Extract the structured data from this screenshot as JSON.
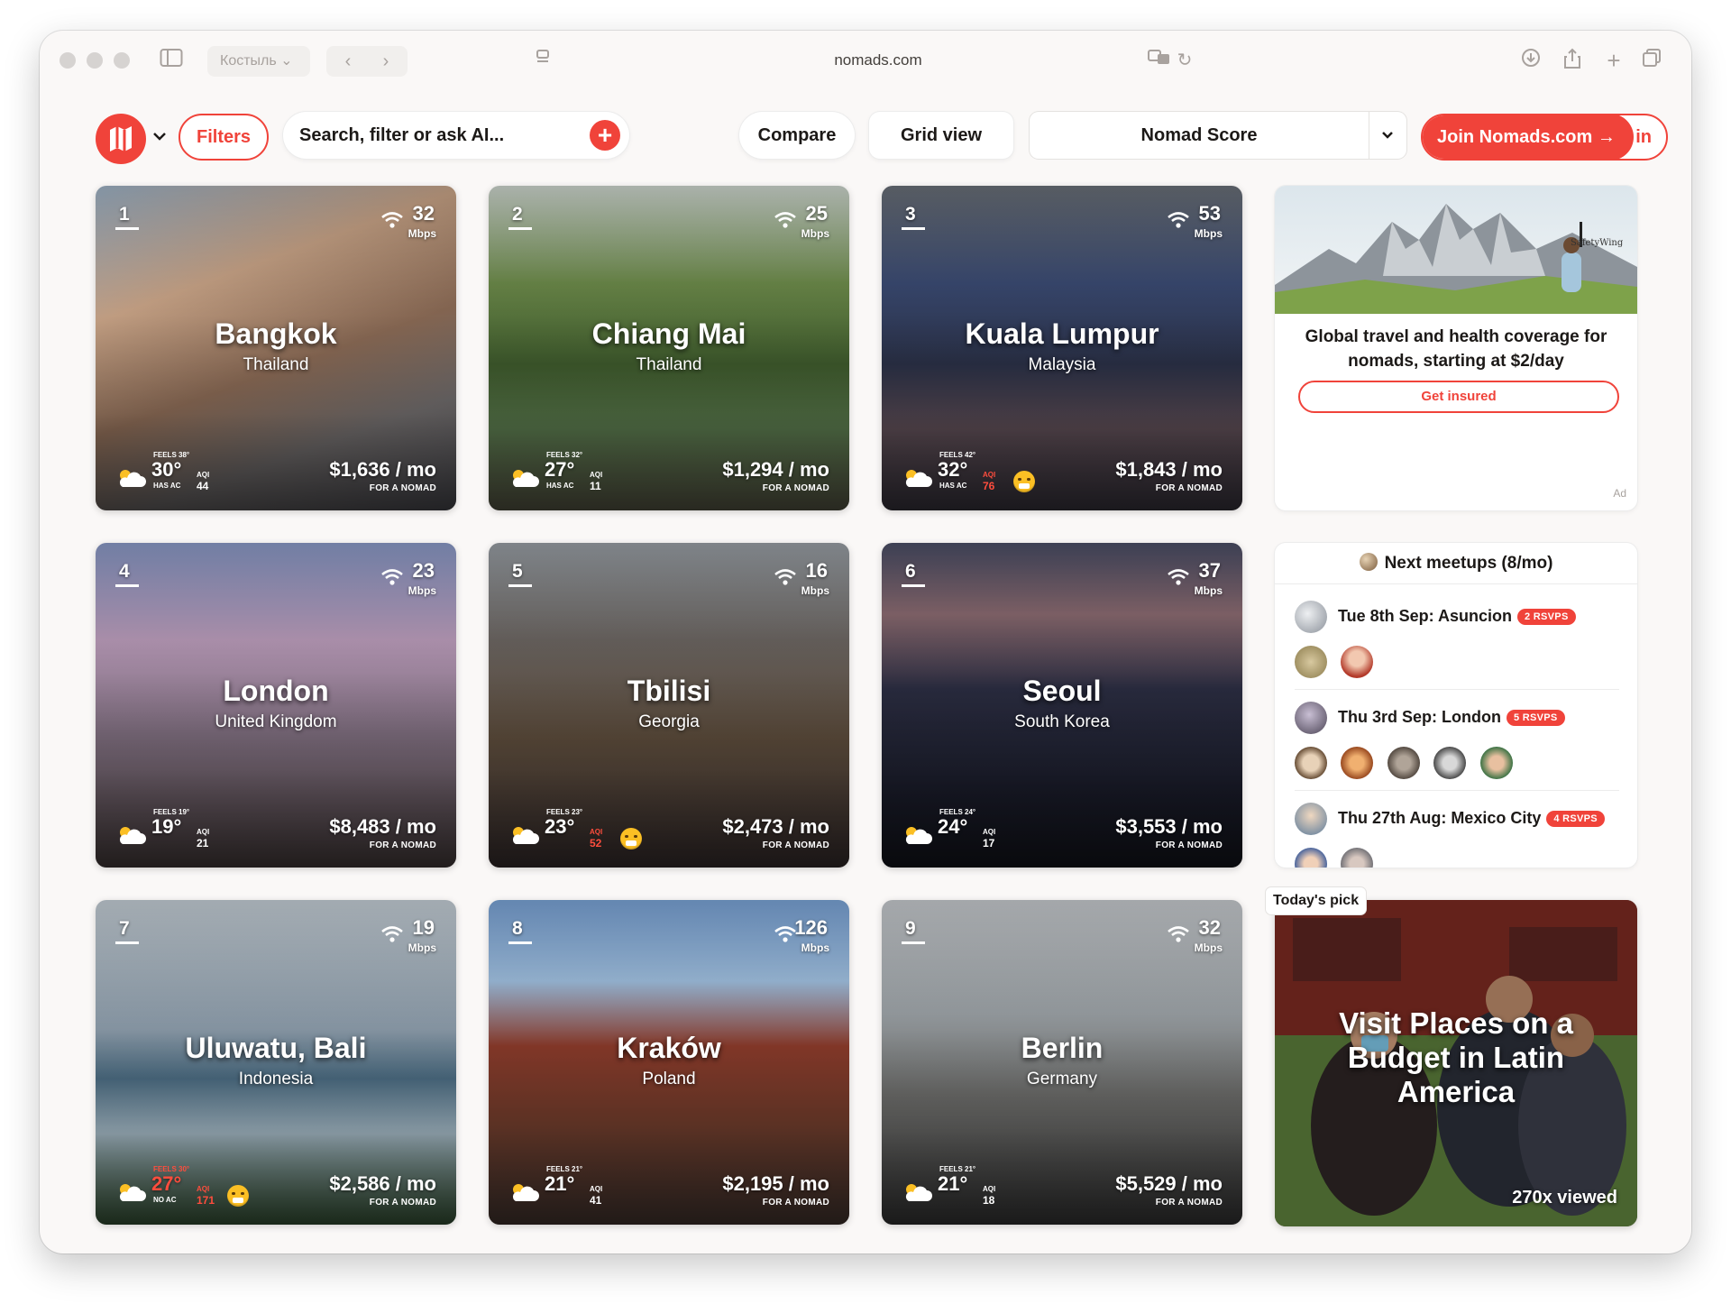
{
  "browser": {
    "profile_label": "Костыль",
    "url": "nomads.com"
  },
  "toolbar": {
    "filters_label": "Filters",
    "search_placeholder": "Search, filter or ask AI...",
    "compare_label": "Compare",
    "grid_view_label": "Grid view",
    "sort_value": "Nomad Score",
    "join_label": "Join Nomads.com →",
    "join_tail": "in"
  },
  "cities": [
    {
      "rank": "1",
      "city": "Bangkok",
      "country": "Thailand",
      "mbps": "32",
      "mbps_unit": "Mbps",
      "feels": "FEELS 38°",
      "temp": "30°",
      "ac": "HAS AC",
      "aqi_label": "AQI",
      "aqi": "44",
      "price": "$1,636 / mo",
      "price_sub": "FOR A NOMAD"
    },
    {
      "rank": "2",
      "city": "Chiang Mai",
      "country": "Thailand",
      "mbps": "25",
      "mbps_unit": "Mbps",
      "feels": "FEELS 32°",
      "temp": "27°",
      "ac": "HAS AC",
      "aqi_label": "AQI",
      "aqi": "11",
      "price": "$1,294 / mo",
      "price_sub": "FOR A NOMAD"
    },
    {
      "rank": "3",
      "city": "Kuala Lumpur",
      "country": "Malaysia",
      "mbps": "53",
      "mbps_unit": "Mbps",
      "feels": "FEELS 42°",
      "temp": "32°",
      "ac": "HAS AC",
      "aqi_label": "AQI",
      "aqi": "76",
      "price": "$1,843 / mo",
      "price_sub": "FOR A NOMAD"
    },
    {
      "rank": "4",
      "city": "London",
      "country": "United Kingdom",
      "mbps": "23",
      "mbps_unit": "Mbps",
      "feels": "FEELS 19°",
      "temp": "19°",
      "ac": "",
      "aqi_label": "AQI",
      "aqi": "21",
      "price": "$8,483 / mo",
      "price_sub": "FOR A NOMAD"
    },
    {
      "rank": "5",
      "city": "Tbilisi",
      "country": "Georgia",
      "mbps": "16",
      "mbps_unit": "Mbps",
      "feels": "FEELS 23°",
      "temp": "23°",
      "ac": "",
      "aqi_label": "AQI",
      "aqi": "52",
      "price": "$2,473 / mo",
      "price_sub": "FOR A NOMAD"
    },
    {
      "rank": "6",
      "city": "Seoul",
      "country": "South Korea",
      "mbps": "37",
      "mbps_unit": "Mbps",
      "feels": "FEELS 24°",
      "temp": "24°",
      "ac": "",
      "aqi_label": "AQI",
      "aqi": "17",
      "price": "$3,553 / mo",
      "price_sub": "FOR A NOMAD"
    },
    {
      "rank": "7",
      "city": "Uluwatu, Bali",
      "country": "Indonesia",
      "mbps": "19",
      "mbps_unit": "Mbps",
      "feels": "FEELS 30°",
      "temp": "27°",
      "ac": "NO AC",
      "aqi_label": "AQI",
      "aqi": "171",
      "price": "$2,586 / mo",
      "price_sub": "FOR A NOMAD"
    },
    {
      "rank": "8",
      "city": "Kraków",
      "country": "Poland",
      "mbps": "126",
      "mbps_unit": "Mbps",
      "feels": "FEELS 21°",
      "temp": "21°",
      "ac": "",
      "aqi_label": "AQI",
      "aqi": "41",
      "price": "$2,195 / mo",
      "price_sub": "FOR A NOMAD"
    },
    {
      "rank": "9",
      "city": "Berlin",
      "country": "Germany",
      "mbps": "32",
      "mbps_unit": "Mbps",
      "feels": "FEELS 21°",
      "temp": "21°",
      "ac": "",
      "aqi_label": "AQI",
      "aqi": "18",
      "price": "$5,529 / mo",
      "price_sub": "FOR A NOMAD"
    }
  ],
  "ad": {
    "brand": "SafetyWing",
    "text": "Global travel and health coverage for nomads, starting at $2/day",
    "button": "Get insured",
    "tag": "Ad"
  },
  "meetups": {
    "title": "Next meetups (8/mo)",
    "items": [
      {
        "title": "Tue 8th Sep: Asuncion",
        "rsvps": "2 RSVPS"
      },
      {
        "title": "Thu 3rd Sep: London",
        "rsvps": "5 RSVPS"
      },
      {
        "title": "Thu 27th Aug: Mexico City",
        "rsvps": "4 RSVPS"
      }
    ]
  },
  "pick": {
    "tag": "Today's pick",
    "title": "Visit Places on a Budget in Latin America",
    "views": "270x viewed"
  },
  "colors": {
    "accent": "#f0433a",
    "bad_aqi": "#ff4d3d"
  }
}
